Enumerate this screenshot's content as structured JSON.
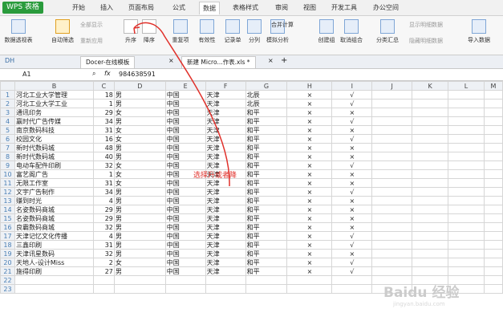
{
  "app": {
    "name": "WPS 表格"
  },
  "menu": {
    "tabs": [
      "开始",
      "插入",
      "页面布局",
      "公式",
      "数据",
      "表格样式",
      "审阅",
      "视图",
      "开发工具",
      "办公空间"
    ],
    "active": 4
  },
  "ribbon": {
    "buttons": [
      "数据透视表",
      "自动筛选",
      "升序",
      "降序",
      "重复项",
      "有效性",
      "记录单",
      "分列",
      "模拟分析",
      "合并计算",
      "创建组",
      "取消组合",
      "分类汇总",
      "导入数据"
    ],
    "small": [
      "全部显示",
      "重新应用",
      "显示明细数据",
      "隐藏明细数据"
    ]
  },
  "quickbar": {
    "label": "DH"
  },
  "tabs": [
    {
      "label": "Docer-在线模板"
    },
    {
      "label": "新建 Micro...作表.xls *"
    }
  ],
  "formula": {
    "cell": "A1",
    "fx": "fx",
    "value": "984638591"
  },
  "columns": [
    "A",
    "B",
    "C",
    "D",
    "E",
    "F",
    "G",
    "H",
    "I",
    "J",
    "K",
    "L",
    "M"
  ],
  "rows": [
    {
      "n": "1",
      "b": "河北工业大学管理",
      "c": "18",
      "d": "男",
      "e": "中国",
      "f": "天津",
      "g": "北辰",
      "h": "×",
      "i": "√"
    },
    {
      "n": "2",
      "b": "河北工业大学工业",
      "c": "1",
      "d": "男",
      "e": "中国",
      "f": "天津",
      "g": "北辰",
      "h": "×",
      "i": "√"
    },
    {
      "n": "3",
      "b": "通讯印务",
      "c": "29",
      "d": "女",
      "e": "中国",
      "f": "天津",
      "g": "和平",
      "h": "×",
      "i": "×"
    },
    {
      "n": "4",
      "b": "赢时代广告传媒",
      "c": "34",
      "d": "男",
      "e": "中国",
      "f": "天津",
      "g": "和平",
      "h": "×",
      "i": "√"
    },
    {
      "n": "5",
      "b": "南京数码科技",
      "c": "31",
      "d": "女",
      "e": "中国",
      "f": "天津",
      "g": "和平",
      "h": "×",
      "i": "×"
    },
    {
      "n": "6",
      "b": "校园文化",
      "c": "16",
      "d": "女",
      "e": "中国",
      "f": "天津",
      "g": "和平",
      "h": "×",
      "i": "√"
    },
    {
      "n": "7",
      "b": "新时代数码城",
      "c": "48",
      "d": "男",
      "e": "中国",
      "f": "天津",
      "g": "和平",
      "h": "×",
      "i": "×"
    },
    {
      "n": "8",
      "b": "新时代数码城",
      "c": "40",
      "d": "男",
      "e": "中国",
      "f": "天津",
      "g": "和平",
      "h": "×",
      "i": "×"
    },
    {
      "n": "9",
      "b": "电动车配件印刷",
      "c": "32",
      "d": "女",
      "e": "中国",
      "f": "天津",
      "g": "和平",
      "h": "×",
      "i": "√"
    },
    {
      "n": "10",
      "b": "富艺阁广告",
      "c": "1",
      "d": "女",
      "e": "中国",
      "f": "天津",
      "g": "和平",
      "h": "×",
      "i": "×"
    },
    {
      "n": "11",
      "b": "无限工作室",
      "c": "31",
      "d": "女",
      "e": "中国",
      "f": "天津",
      "g": "和平",
      "h": "×",
      "i": "×"
    },
    {
      "n": "12",
      "b": "文宇广告制作",
      "c": "34",
      "d": "男",
      "e": "中国",
      "f": "天津",
      "g": "和平",
      "h": "×",
      "i": "√"
    },
    {
      "n": "13",
      "b": "赚到时光",
      "c": "4",
      "d": "男",
      "e": "中国",
      "f": "天津",
      "g": "和平",
      "h": "×",
      "i": "×"
    },
    {
      "n": "14",
      "b": "名姿数码商城",
      "c": "29",
      "d": "男",
      "e": "中国",
      "f": "天津",
      "g": "和平",
      "h": "×",
      "i": "×"
    },
    {
      "n": "15",
      "b": "名姿数码商城",
      "c": "29",
      "d": "男",
      "e": "中国",
      "f": "天津",
      "g": "和平",
      "h": "×",
      "i": "×"
    },
    {
      "n": "16",
      "b": "良霸数码商城",
      "c": "32",
      "d": "男",
      "e": "中国",
      "f": "天津",
      "g": "和平",
      "h": "×",
      "i": "×"
    },
    {
      "n": "17",
      "b": "天津记忆文化传播",
      "c": "4",
      "d": "男",
      "e": "中国",
      "f": "天津",
      "g": "和平",
      "h": "×",
      "i": "√"
    },
    {
      "n": "18",
      "b": "三鑫印刷",
      "c": "31",
      "d": "男",
      "e": "中国",
      "f": "天津",
      "g": "和平",
      "h": "×",
      "i": "√"
    },
    {
      "n": "19",
      "b": "天津讯星数码",
      "c": "32",
      "d": "男",
      "e": "中国",
      "f": "天津",
      "g": "和平",
      "h": "×",
      "i": "×"
    },
    {
      "n": "20",
      "b": "天地人-设计Miss",
      "c": "2",
      "d": "女",
      "e": "中国",
      "f": "天津",
      "g": "和平",
      "h": "×",
      "i": "√"
    },
    {
      "n": "21",
      "b": "施得印刷",
      "c": "27",
      "d": "男",
      "e": "中国",
      "f": "天津",
      "g": "和平",
      "h": "×",
      "i": "√"
    },
    {
      "n": "22",
      "b": "",
      "c": "",
      "d": "",
      "e": "",
      "f": "",
      "g": "",
      "h": "",
      "i": ""
    },
    {
      "n": "23",
      "b": "",
      "c": "",
      "d": "",
      "e": "",
      "f": "",
      "g": "",
      "h": "",
      "i": ""
    }
  ],
  "annotation": {
    "text": "选择升或者降"
  },
  "watermark": {
    "text": "Baidu 经验",
    "sub": "jingyan.baidu.com"
  }
}
